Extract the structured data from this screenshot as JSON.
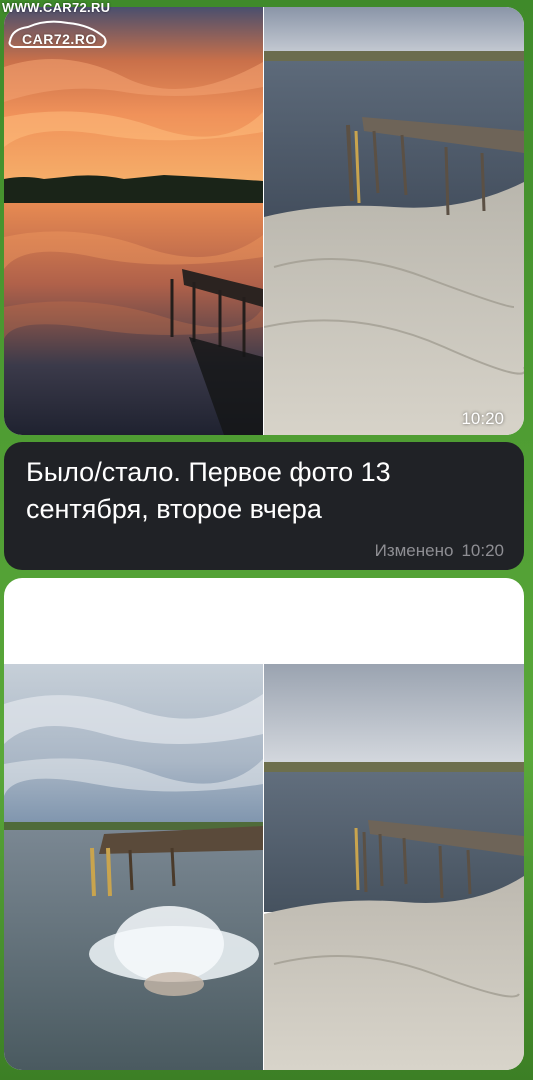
{
  "watermark": {
    "site": "WWW.CAR72.RU",
    "logo_text": "CAR72.RO"
  },
  "photos": {
    "top_left": "sunset-lake-pier-photo",
    "top_right": "drained-lake-sand-pier-photo",
    "bottom_left": "swimmer-splash-lake-photo",
    "bottom_right": "drained-lake-sand-pier-photo-2"
  },
  "media_time": "10:20",
  "message": {
    "text": "Было/стало. Первое фото 13 сентября, второе вчера",
    "edited_label": "Изменено",
    "time": "10:20"
  },
  "colors": {
    "bubble_bg": "#202226",
    "meta_text": "#8e8e93",
    "background_grass": "#4f9d33"
  }
}
